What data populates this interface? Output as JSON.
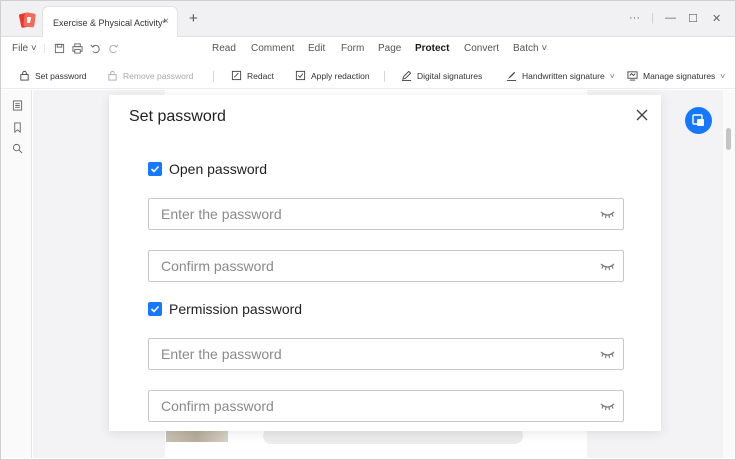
{
  "window": {
    "tab_title": "Exercise & Physical Activity*",
    "tab_close": "×",
    "new_tab": "+",
    "controls": {
      "more": "···",
      "minimize": "—",
      "maximize": "☐",
      "close": "✕"
    }
  },
  "menu": {
    "file": "File",
    "items": [
      "Read",
      "Comment",
      "Edit",
      "Form",
      "Page",
      "Protect",
      "Convert",
      "Batch"
    ],
    "active": "Protect"
  },
  "toolbar": {
    "set_password": "Set password",
    "remove_password": "Remove password",
    "redact": "Redact",
    "apply_redaction": "Apply redaction",
    "digital_signatures": "Digital signatures",
    "handwritten_signature": "Handwritten signature",
    "manage_signatures": "Manage signatures"
  },
  "dialog": {
    "title": "Set password",
    "open_password": {
      "label": "Open password",
      "checked": true,
      "enter_placeholder": "Enter the password",
      "confirm_placeholder": "Confirm password"
    },
    "permission_password": {
      "label": "Permission password",
      "checked": true,
      "enter_placeholder": "Enter the password",
      "confirm_placeholder": "Confirm password"
    }
  },
  "colors": {
    "accent": "#1677ff",
    "app_logo": "#e8372c"
  },
  "icons": [
    "app-logo-icon",
    "save-icon",
    "print-icon",
    "undo-icon",
    "redo-icon",
    "lock-icon",
    "unlock-icon",
    "redact-icon",
    "apply-redaction-icon",
    "pen-icon",
    "handwriting-icon",
    "manage-signatures-icon",
    "thumbnails-icon",
    "bookmark-icon",
    "search-icon",
    "close-icon",
    "eye-closed-icon",
    "check-icon"
  ]
}
